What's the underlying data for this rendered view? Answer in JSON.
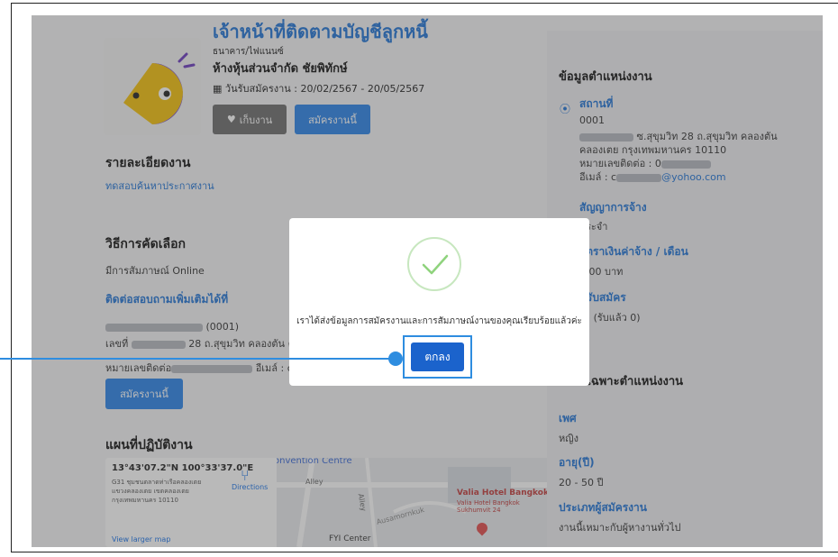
{
  "job": {
    "title": "เจ้าหน้าที่ติดตามบัญชีลูกหนี้",
    "type": "ธนาคาร/ไฟแนนซ์",
    "company": "ห้างหุ้นส่วนจำกัด ชัยพิทักษ์",
    "dates": "วันรับสมัครงาน : 20/02/2567 - 20/05/2567",
    "save_label": "เก็บงาน",
    "apply_label": "สมัครงานนี้"
  },
  "details": {
    "heading": "รายละเอียดงาน",
    "text": "ทดสอบค้นหาประกาศงาน"
  },
  "selection": {
    "heading": "วิธีการคัดเลือก",
    "text": "มีการสัมภาษณ์ Online"
  },
  "contact": {
    "heading": "ติดต่อสอบถามเพิ่มเติมได้ที่",
    "name_suffix": "(0001)",
    "address_prefix": "เลขที่",
    "address_rest": "28 ถ.สุขุมวิท คลองตัน คล",
    "phone_label": "หมายเลขติดต่อ",
    "email_label": "อีเมล์ : c",
    "apply_label": "สมัครงานนี้"
  },
  "map_section": {
    "heading": "แผนที่ปฏิบัติงาน",
    "coords": "13°43'07.2\"N 100°33'37.0\"E",
    "address": "G31 ชุมชนตลาดท่าเรือคลองเตย แขวงคลองเตย เขตคลองเตย กรุงเทพมหานคร 10110",
    "directions": "Directions",
    "view_larger": "View larger map",
    "poi1": "Convention Centre",
    "poi2": "Valia Hotel Bangkok",
    "poi2_sub": "Valia Hotel Bangkok Sukhumvit 24",
    "poi3": "FYI Center",
    "street1": "Alley",
    "street2": "Alley",
    "street3": "Ausamornkuk"
  },
  "position_info": {
    "heading": "ข้อมูลตำแหน่งงาน",
    "location_label": "สถานที่",
    "location_code": "0001",
    "address_line1": "ซ.สุขุมวิท 28 ถ.สุขุมวิท คลองตัน",
    "address_line2": "คลองเตย กรุงเทพมหานคร 10110",
    "phone_label": "หมายเลขติดต่อ : 0",
    "email_label": "อีเมล์ : c",
    "email_domain": "@yohoo.com",
    "contract_label": "สัญญาการจ้าง",
    "contract_value": "ประจำ",
    "salary_label": "อัตราเงินค่าจ้าง / เดือน",
    "salary_value": ",000 บาท",
    "openings_label": "ที่รับสมัคร",
    "openings_value": "รา (รับแล้ว 0)"
  },
  "qualifications": {
    "heading": "ติเฉพาะตำแหน่งงาน",
    "gender_label": "เพศ",
    "gender_value": "หญิง",
    "age_label": "อายุ(ปี)",
    "age_value": "20 - 50 ปี",
    "applicant_label": "ประเภทผู้สมัครงาน",
    "applicant_value": "งานนี้เหมาะกับผู้หางานทั่วไป"
  },
  "modal": {
    "message": "เราได้ส่งข้อมูลการสมัครงานและการสัมภาษณ์งานของคุณเรียบร้อยแล้วค่ะ",
    "ok_label": "ตกลง"
  },
  "colors": {
    "accent": "#1f73d6",
    "button": "#2a83e8",
    "ok_button": "#1b63cc",
    "highlight": "#2e8de0",
    "check": "#8fd37d",
    "logo_yellow": "#f4c10a",
    "logo_purple": "#6b3bbf"
  }
}
